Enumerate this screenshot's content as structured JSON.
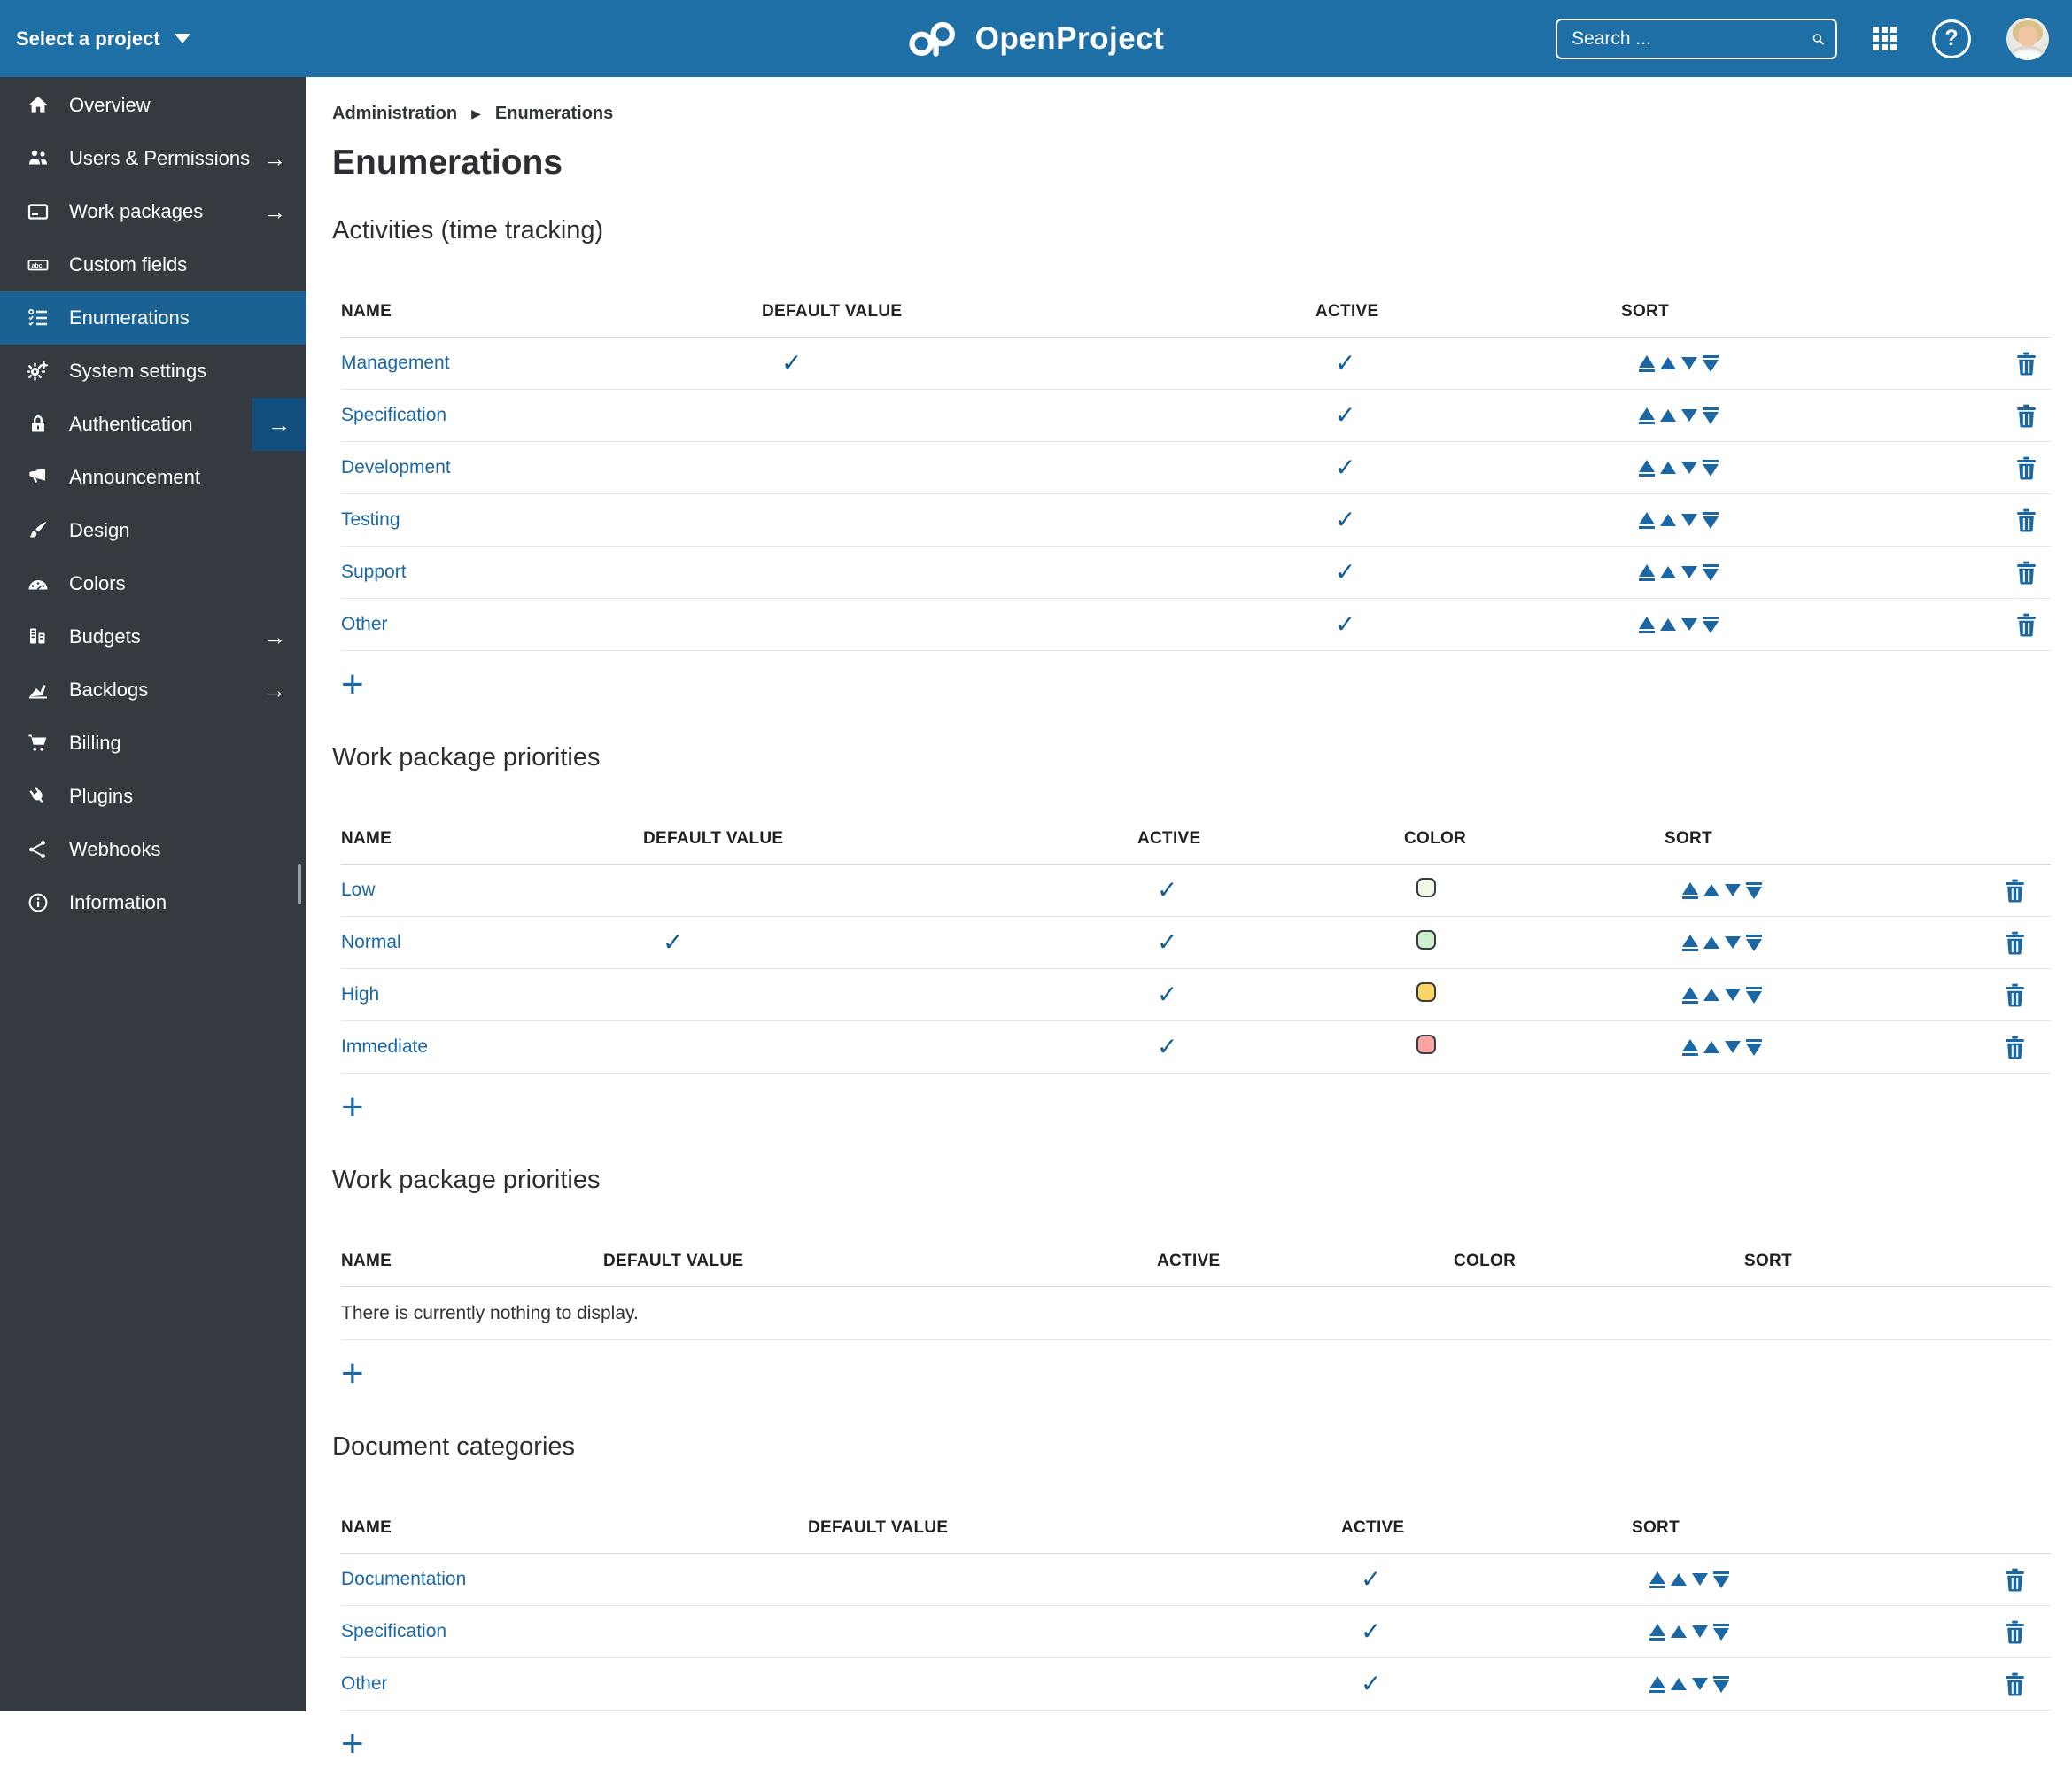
{
  "topbar": {
    "project_selector": "Select a project",
    "brand": "OpenProject",
    "search_placeholder": "Search ...",
    "help_glyph": "?"
  },
  "sidebar": {
    "items": [
      {
        "label": "Overview",
        "icon": "home",
        "arrow": false,
        "active": false
      },
      {
        "label": "Users & Permissions",
        "icon": "users",
        "arrow": true,
        "active": false
      },
      {
        "label": "Work packages",
        "icon": "work-packages",
        "arrow": true,
        "active": false
      },
      {
        "label": "Custom fields",
        "icon": "custom-fields",
        "arrow": false,
        "active": false
      },
      {
        "label": "Enumerations",
        "icon": "enumerations",
        "arrow": false,
        "active": true
      },
      {
        "label": "System settings",
        "icon": "settings",
        "arrow": false,
        "active": false
      },
      {
        "label": "Authentication",
        "icon": "lock",
        "arrow": true,
        "active": false,
        "arrow_boxed": true
      },
      {
        "label": "Announcement",
        "icon": "megaphone",
        "arrow": false,
        "active": false
      },
      {
        "label": "Design",
        "icon": "brush",
        "arrow": false,
        "active": false
      },
      {
        "label": "Colors",
        "icon": "palette",
        "arrow": false,
        "active": false
      },
      {
        "label": "Budgets",
        "icon": "budget",
        "arrow": true,
        "active": false
      },
      {
        "label": "Backlogs",
        "icon": "backlogs",
        "arrow": true,
        "active": false
      },
      {
        "label": "Billing",
        "icon": "cart",
        "arrow": false,
        "active": false
      },
      {
        "label": "Plugins",
        "icon": "plug",
        "arrow": false,
        "active": false
      },
      {
        "label": "Webhooks",
        "icon": "webhooks",
        "arrow": false,
        "active": false
      },
      {
        "label": "Information",
        "icon": "info",
        "arrow": false,
        "active": false
      }
    ]
  },
  "breadcrumb": {
    "items": [
      "Administration",
      "Enumerations"
    ]
  },
  "page": {
    "title": "Enumerations"
  },
  "sections": [
    {
      "heading": "Activities (time tracking)",
      "columns": [
        "NAME",
        "DEFAULT VALUE",
        "ACTIVE",
        "SORT"
      ],
      "has_color": false,
      "rows": [
        {
          "name": "Management",
          "default": true,
          "active": true
        },
        {
          "name": "Specification",
          "default": false,
          "active": true
        },
        {
          "name": "Development",
          "default": false,
          "active": true
        },
        {
          "name": "Testing",
          "default": false,
          "active": true
        },
        {
          "name": "Support",
          "default": false,
          "active": true
        },
        {
          "name": "Other",
          "default": false,
          "active": true
        }
      ]
    },
    {
      "heading": "Work package priorities",
      "columns": [
        "NAME",
        "DEFAULT VALUE",
        "ACTIVE",
        "COLOR",
        "SORT"
      ],
      "has_color": true,
      "rows": [
        {
          "name": "Low",
          "default": false,
          "active": true,
          "color": "#F2F9E8"
        },
        {
          "name": "Normal",
          "default": true,
          "active": true,
          "color": "#CCEFCC"
        },
        {
          "name": "High",
          "default": false,
          "active": true,
          "color": "#FCD664"
        },
        {
          "name": "Immediate",
          "default": false,
          "active": true,
          "color": "#FBA4A4"
        }
      ]
    },
    {
      "heading": "Work package priorities",
      "columns": [
        "NAME",
        "DEFAULT VALUE",
        "ACTIVE",
        "COLOR",
        "SORT"
      ],
      "has_color": true,
      "rows": [],
      "empty_text": "There is currently nothing to display."
    },
    {
      "heading": "Document categories",
      "columns": [
        "NAME",
        "DEFAULT VALUE",
        "ACTIVE",
        "SORT"
      ],
      "has_color": false,
      "rows": [
        {
          "name": "Documentation",
          "default": false,
          "active": true
        },
        {
          "name": "Specification",
          "default": false,
          "active": true
        },
        {
          "name": "Other",
          "default": false,
          "active": true
        }
      ]
    }
  ],
  "ui": {
    "check_glyph": "✓",
    "add_label": "+",
    "arrow_glyph": "→",
    "breadcrumb_separator": "▶"
  },
  "colors": {
    "topbar_bg": "#1D6FA5",
    "sidebar_bg": "#343A40",
    "sidebar_active_bg": "#1A6293",
    "arrow_box_bg": "#134F7E",
    "link": "#1A67A3",
    "check": "#155E93",
    "priority_low": "#F2F9E8",
    "priority_normal": "#CCEFCC",
    "priority_high": "#FCD664",
    "priority_immediate": "#FBA4A4"
  }
}
